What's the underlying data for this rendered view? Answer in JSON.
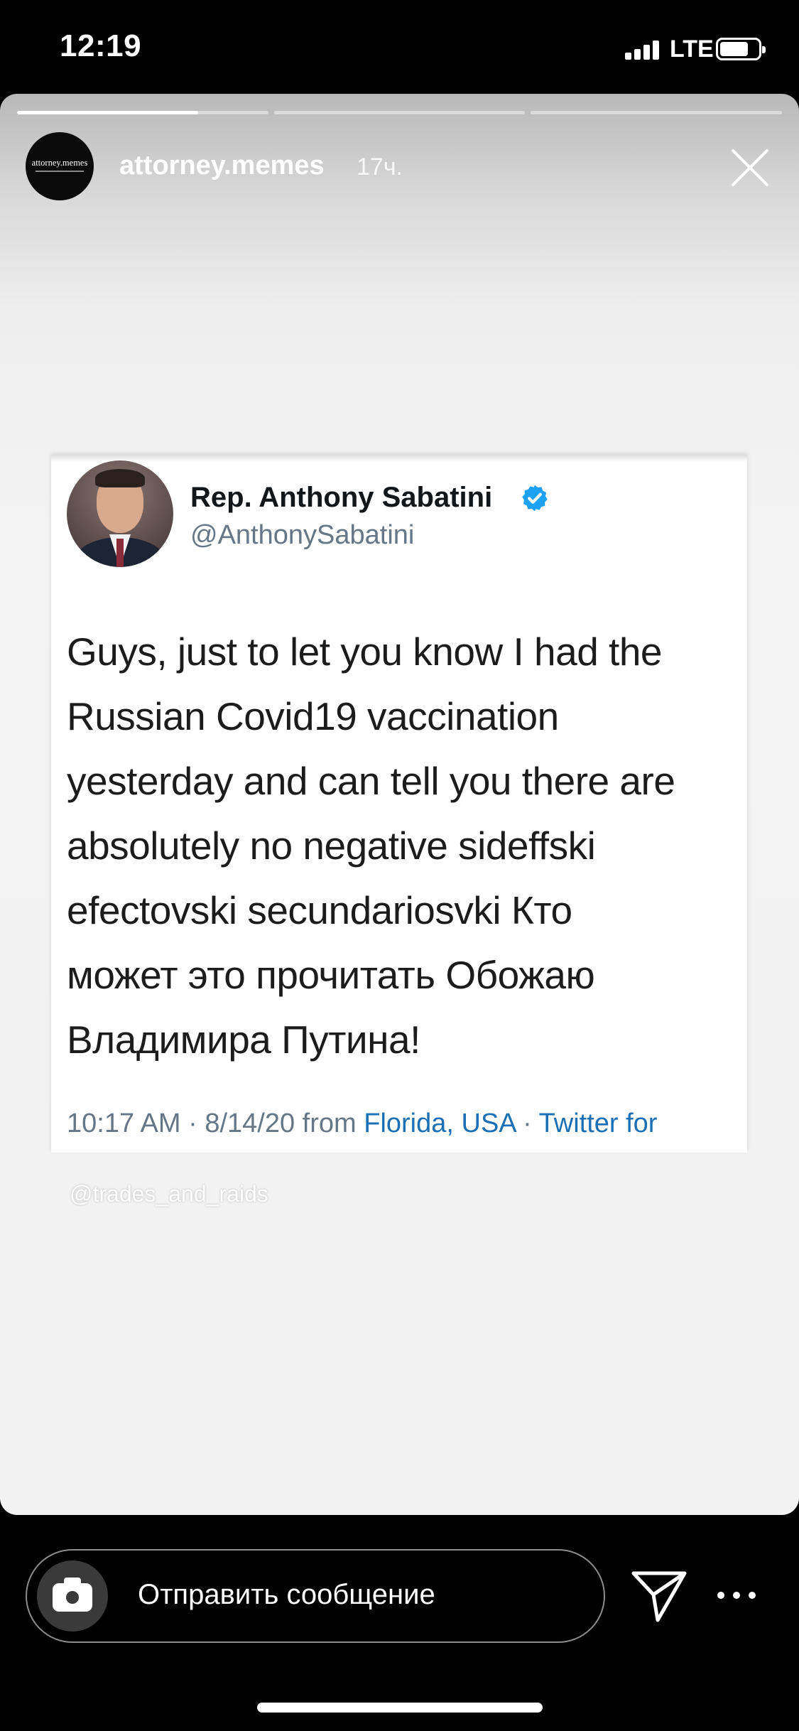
{
  "status_bar": {
    "time": "12:19",
    "network": "LTE",
    "signal_icon": "signal-bars-icon",
    "battery_icon": "battery-icon",
    "battery_level": 0.75
  },
  "story": {
    "username": "attorney.memes",
    "time_ago": "17ч.",
    "avatar_text": "attorney.memes",
    "progress_segments": 3,
    "current_segment_progress": 0.72,
    "close_icon": "close-icon"
  },
  "tweet": {
    "display_name": "Rep. Anthony Sabatini",
    "verified_icon": "verified-badge-icon",
    "handle": "@AnthonySabatini",
    "body": "Guys, just to let you know I had the\nRussian Covid19 vaccination\nyesterday and can tell you there are\nabsolutely no negative sideffski\nefectovski secundariosvki Кто\nможет это прочитать Обожаю\nВладимира Путина!",
    "meta_time": "10:17 AM · 8/14/20 from ",
    "meta_location": "Florida, USA",
    "meta_sep": " · ",
    "meta_source": "Twitter for"
  },
  "watermark": "@trades_and_raids",
  "reply_bar": {
    "placeholder": "Отправить сообщение",
    "camera_icon": "camera-icon",
    "send_icon": "send-icon",
    "more_icon": "more-options-icon"
  },
  "colors": {
    "tweet_link": "#1b6fb4",
    "verified": "#1da1f2",
    "handle_gray": "#657786"
  }
}
